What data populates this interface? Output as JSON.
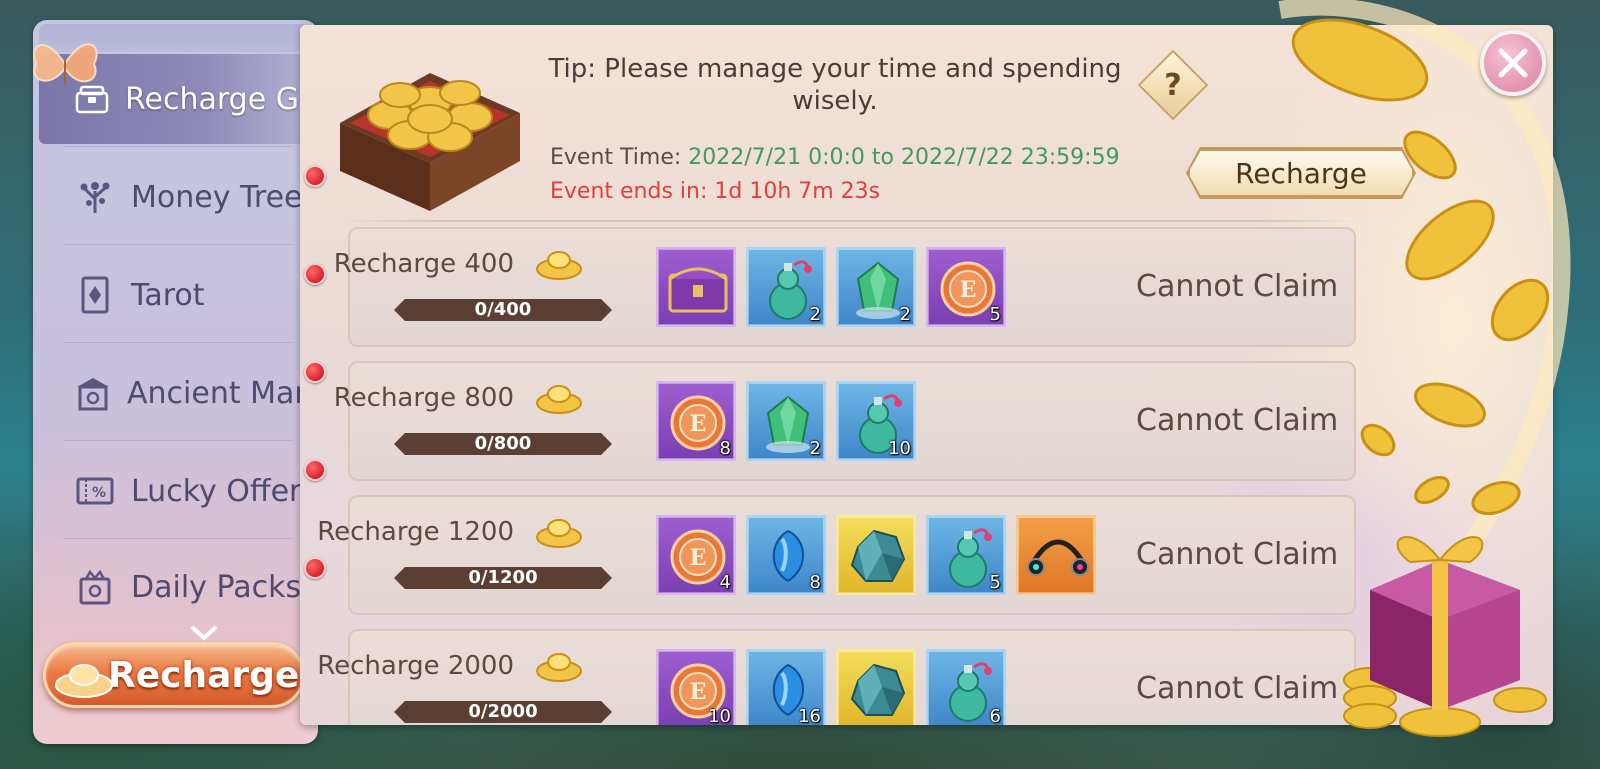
{
  "sidebar": {
    "items": [
      {
        "label": "Recharge Gift",
        "icon": "gift-box-icon",
        "active": true
      },
      {
        "label": "Money Tree",
        "icon": "tree-icon"
      },
      {
        "label": "Tarot",
        "icon": "tarot-card-icon"
      },
      {
        "label": "Ancient Market",
        "icon": "market-building-icon"
      },
      {
        "label": "Lucky Offer",
        "icon": "discount-ticket-icon"
      },
      {
        "label": "Daily Packs",
        "icon": "daily-pack-icon"
      }
    ],
    "recharge_button": "Recharge"
  },
  "header": {
    "tip": "Tip: Please manage your time and spending wisely.",
    "help_label": "?",
    "event_time_label": "Event Time:",
    "event_time_value": "2022/7/21 0:0:0 to 2022/7/22 23:59:59",
    "event_ends": "Event ends in: 1d 10h 7m 23s",
    "recharge_button": "Recharge"
  },
  "tiers": [
    {
      "label": "Recharge 400",
      "progress_text": "0/400",
      "progress_value": 0,
      "status": "Cannot Claim",
      "items": [
        {
          "icon": "treasure-chest-icon",
          "rarity": "purple",
          "qty": ""
        },
        {
          "icon": "potion-gourd-icon",
          "rarity": "blue",
          "qty": "2"
        },
        {
          "icon": "emerald-crystal-icon",
          "rarity": "blue",
          "qty": "2"
        },
        {
          "icon": "exp-orb-icon",
          "rarity": "purple",
          "qty": "5"
        }
      ]
    },
    {
      "label": "Recharge 800",
      "progress_text": "0/800",
      "progress_value": 0,
      "status": "Cannot Claim",
      "items": [
        {
          "icon": "exp-orb-icon",
          "rarity": "purple",
          "qty": "8"
        },
        {
          "icon": "emerald-crystal-icon",
          "rarity": "blue",
          "qty": "2"
        },
        {
          "icon": "potion-gourd-icon",
          "rarity": "blue",
          "qty": "10"
        }
      ]
    },
    {
      "label": "Recharge 1200",
      "progress_text": "0/1200",
      "progress_value": 0,
      "status": "Cannot Claim",
      "items": [
        {
          "icon": "exp-orb-icon",
          "rarity": "purple",
          "qty": "4"
        },
        {
          "icon": "blue-gem-icon",
          "rarity": "blue",
          "qty": "8"
        },
        {
          "icon": "ore-stone-icon",
          "rarity": "gold",
          "qty": ""
        },
        {
          "icon": "potion-gourd-icon",
          "rarity": "blue",
          "qty": "5"
        },
        {
          "icon": "headphone-accessory-icon",
          "rarity": "orange",
          "qty": ""
        }
      ]
    },
    {
      "label": "Recharge 2000",
      "progress_text": "0/2000",
      "progress_value": 0,
      "status": "Cannot Claim",
      "items": [
        {
          "icon": "exp-orb-icon",
          "rarity": "purple",
          "qty": "10"
        },
        {
          "icon": "blue-gem-icon",
          "rarity": "blue",
          "qty": "16"
        },
        {
          "icon": "ore-stone-icon",
          "rarity": "gold",
          "qty": ""
        },
        {
          "icon": "potion-gourd-icon",
          "rarity": "blue",
          "qty": "6"
        }
      ]
    }
  ],
  "colors": {
    "event_time_value": "#3f9a5c",
    "event_ends": "#e0403c",
    "sidebar_active": "#8f8ab8"
  }
}
